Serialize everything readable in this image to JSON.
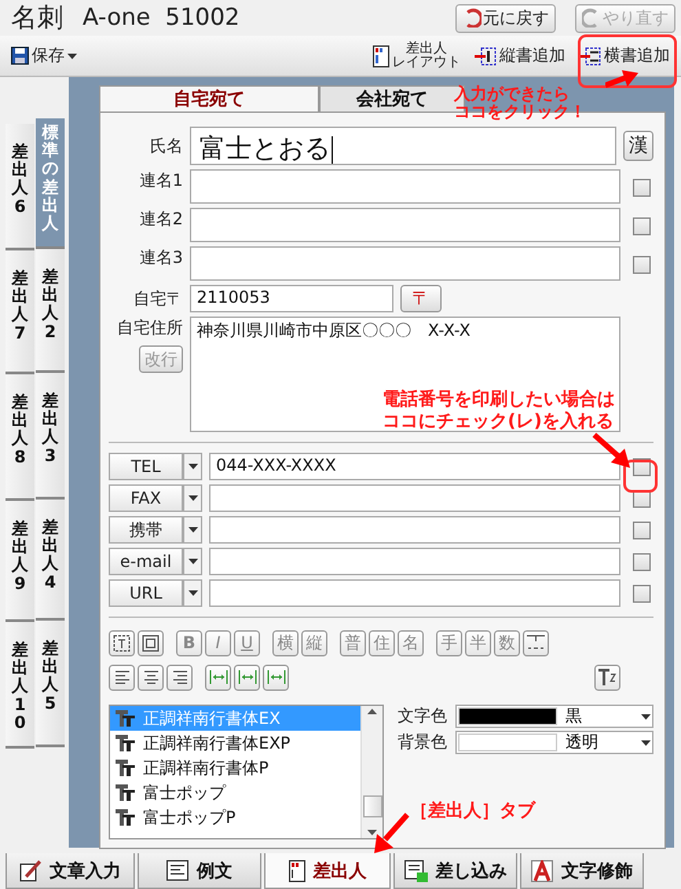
{
  "window": {
    "title": "名刺",
    "subtitle": "A-one  51002"
  },
  "history_buttons": [
    {
      "kind": "undo",
      "label": "元に戻す",
      "disabled": false
    },
    {
      "kind": "redo",
      "label": "やり直す",
      "disabled": true
    }
  ],
  "toolbar": {
    "save": "保存",
    "items": [
      {
        "kind": "layout",
        "label_top": "差出人",
        "label_bottom": "レイアウト"
      },
      {
        "kind": "vertical",
        "label": "縦書追加"
      },
      {
        "kind": "horizontal",
        "label": "横書追加"
      }
    ]
  },
  "sender_tabs": {
    "left": [
      {
        "label": "差出人6",
        "selected": false
      },
      {
        "label": "差出人7",
        "selected": false
      },
      {
        "label": "差出人8",
        "selected": false
      },
      {
        "label": "差出人9",
        "selected": false
      },
      {
        "label": "差出人10",
        "selected": false
      }
    ],
    "right": [
      {
        "label": "標準の差出人",
        "selected": true
      },
      {
        "label": "差出人2",
        "selected": false
      },
      {
        "label": "差出人3",
        "selected": false
      },
      {
        "label": "差出人4",
        "selected": false
      },
      {
        "label": "差出人5",
        "selected": false
      }
    ]
  },
  "address_tabs": [
    {
      "label": "自宅宛て",
      "selected": true
    },
    {
      "label": "会社宛て",
      "selected": false
    }
  ],
  "name": {
    "label": "氏名",
    "value": "富士とおる",
    "kanji_button": "漢"
  },
  "joint_names": [
    {
      "label": "連名1",
      "checked": false
    },
    {
      "label": "連名2",
      "checked": false
    },
    {
      "label": "連名3",
      "checked": false
    }
  ],
  "postal": {
    "label": "自宅〒",
    "value": "2110053",
    "button": "〒"
  },
  "address": {
    "label": "自宅住所",
    "value": "神奈川県川崎市中原区〇〇〇　X-X-X",
    "newline_button": "改行",
    "newline_disabled": true
  },
  "contacts": [
    {
      "type": "TEL",
      "value": "044-XXX-XXXX",
      "checked": false
    },
    {
      "type": "FAX",
      "checked": false
    },
    {
      "type": "携帯",
      "checked": false
    },
    {
      "type": "e-mail",
      "checked": false
    },
    {
      "type": "URL",
      "checked": false
    }
  ],
  "format_rows": [
    [
      [
        {
          "kind": "frame"
        },
        {
          "kind": "box"
        }
      ],
      [
        {
          "kind": "text",
          "label": "B"
        },
        {
          "kind": "text",
          "label": "I"
        },
        {
          "kind": "text",
          "label": "U"
        }
      ],
      [
        {
          "kind": "text",
          "label": "横"
        },
        {
          "kind": "text",
          "label": "縦"
        }
      ],
      [
        {
          "kind": "text",
          "label": "普"
        },
        {
          "kind": "text",
          "label": "住"
        },
        {
          "kind": "text",
          "label": "名"
        }
      ],
      [
        {
          "kind": "text",
          "label": "手"
        },
        {
          "kind": "text",
          "label": "半"
        },
        {
          "kind": "text",
          "label": "数"
        },
        {
          "kind": "numbers"
        }
      ]
    ],
    [
      [
        {
          "kind": "align_left"
        },
        {
          "kind": "align_center"
        },
        {
          "kind": "align_right"
        }
      ],
      [
        {
          "kind": "spacing"
        },
        {
          "kind": "spacing"
        },
        {
          "kind": "spacing"
        }
      ],
      [
        {
          "kind": "superscript"
        }
      ]
    ]
  ],
  "fonts": [
    {
      "name": "正調祥南行書体EX",
      "selected": true
    },
    {
      "name": "正調祥南行書体EXP",
      "selected": false
    },
    {
      "name": "正調祥南行書体P",
      "selected": false
    },
    {
      "name": "富士ポップ",
      "selected": false
    },
    {
      "name": "富士ポップP",
      "selected": false
    }
  ],
  "colors": [
    {
      "label": "文字色",
      "color": "#000000",
      "value": "黒"
    },
    {
      "label": "背景色",
      "color": "#ffffff",
      "value": "透明"
    }
  ],
  "bottom_tabs": [
    {
      "kind": "text",
      "label": "文章入力",
      "selected": false
    },
    {
      "kind": "example",
      "label": "例文",
      "selected": false
    },
    {
      "kind": "sender",
      "label": "差出人",
      "selected": true
    },
    {
      "kind": "merge",
      "label": "差し込み",
      "selected": false
    },
    {
      "kind": "decoration",
      "label": "文字修飾",
      "selected": false
    }
  ],
  "annotations": [
    {
      "lines": [
        "入力ができたら",
        "ココをクリック！"
      ]
    },
    {
      "lines": [
        "電話番号を印刷したい場合は",
        "ココにチェック(レ)を入れる"
      ]
    },
    {
      "lines": [
        "［差出人］タブ"
      ]
    }
  ]
}
